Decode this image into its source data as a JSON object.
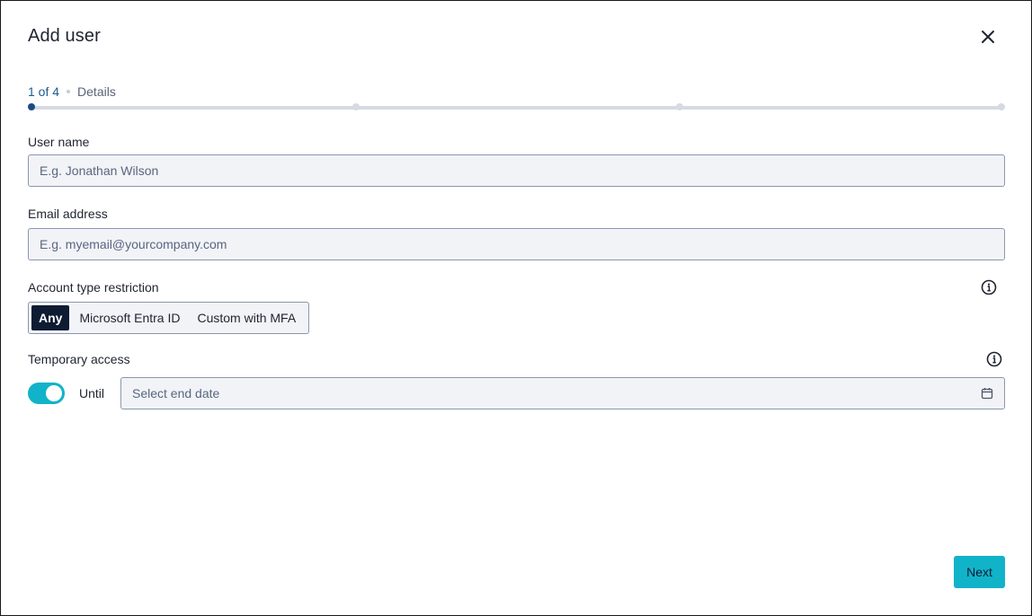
{
  "dialog": {
    "title": "Add user"
  },
  "stepper": {
    "count_label": "1 of 4",
    "step_name": "Details",
    "total_steps": 4,
    "current_step": 1,
    "active_color": "#1d4a86",
    "inactive_color": "#d5dae3"
  },
  "form": {
    "user_name": {
      "label": "User name",
      "value": "",
      "placeholder": "E.g. Jonathan Wilson"
    },
    "email": {
      "label": "Email address",
      "value": "",
      "placeholder": "E.g. myemail@yourcompany.com"
    },
    "account_type": {
      "label": "Account type restriction",
      "info_icon": "info-icon",
      "options": [
        "Any",
        "Microsoft Entra ID",
        "Custom with MFA"
      ],
      "selected": "Any"
    },
    "temporary_access": {
      "label": "Temporary access",
      "info_icon": "info-icon",
      "toggle_on": true,
      "until_label": "Until",
      "date_placeholder": "Select end date",
      "calendar_icon": "calendar-icon"
    }
  },
  "footer": {
    "next_label": "Next"
  },
  "colors": {
    "accent": "#11b3c9",
    "selected_segment": "#0d1b33",
    "step_text": "#1d5a92",
    "input_background": "#f1f3f7",
    "input_border": "#8b96ad"
  }
}
